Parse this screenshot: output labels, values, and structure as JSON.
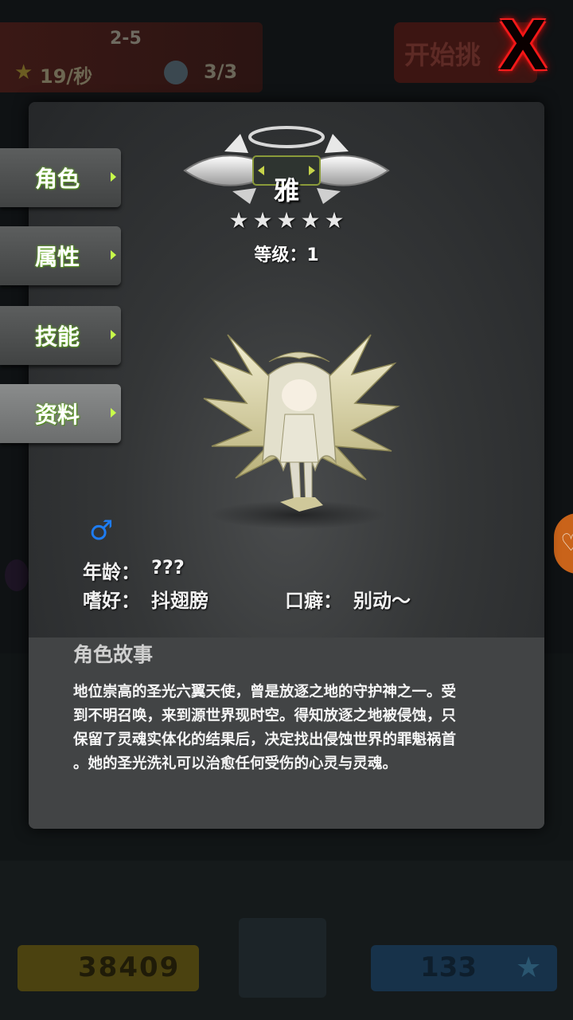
{
  "background": {
    "stage": "2-5",
    "rate": "19/秒",
    "lives": "3/3",
    "start_button": "开始挑",
    "coins": "38409",
    "gems": "133"
  },
  "close_button": {
    "glyph": "X"
  },
  "tabs": [
    {
      "label": "角色",
      "active": false
    },
    {
      "label": "属性",
      "active": false
    },
    {
      "label": "技能",
      "active": false
    },
    {
      "label": "资料",
      "active": true
    }
  ],
  "character": {
    "name": "雅",
    "star_count": 5,
    "stars": [
      "★",
      "★",
      "★",
      "★",
      "★"
    ],
    "level_text": "等级：1",
    "gender_symbol": "♂"
  },
  "info": {
    "age_label": "年龄：",
    "age_value": "???",
    "hobby_label": "嗜好：",
    "hobby_value": "抖翅膀",
    "catchphrase_label": "口癖：",
    "catchphrase_value": "别动～"
  },
  "story": {
    "title": "角色故事",
    "lines": [
      "地位崇高的圣光六翼天使，曾是放逐之地的守护神之一。受",
      "到不明召唤，来到源世界现时空。得知放逐之地被侵蚀，只",
      "保留了灵魂实体化的结果后，决定找出侵蚀世界的罪魁祸首",
      "。她的圣光洗礼可以治愈任何受伤的心灵与灵魂。"
    ]
  },
  "colors": {
    "close_glow": "#ff1a1a",
    "tab_label_glow": "#7ec03a",
    "gender_blue": "#1e7cf2"
  }
}
